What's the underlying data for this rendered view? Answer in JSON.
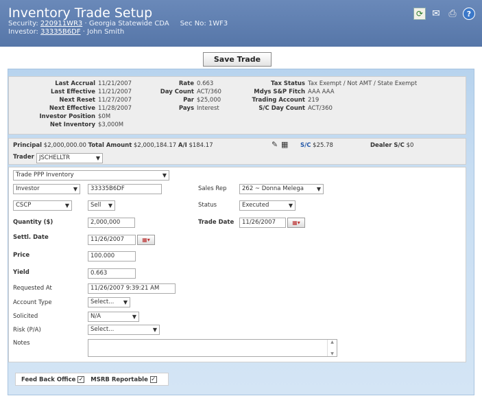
{
  "header": {
    "title": "Inventory Trade Setup",
    "security_label": "Security:",
    "security_id": "220911WR3",
    "security_desc": "· Georgia Statewide CDA",
    "sec_no": "Sec No: 1WF3",
    "investor_label": "Investor:",
    "investor_id": "33335B6DF",
    "investor_name": "· John Smith",
    "icons": [
      "refresh-icon",
      "mail-icon",
      "print-icon",
      "help-icon"
    ]
  },
  "save_label": "Save Trade",
  "summary": {
    "col1": [
      {
        "label": "Last Accrual",
        "value": "11/21/2007"
      },
      {
        "label": "Last Effective",
        "value": "11/21/2007"
      },
      {
        "label": "Next Reset",
        "value": "11/27/2007"
      },
      {
        "label": "Next Effective",
        "value": "11/28/2007"
      },
      {
        "label": "Investor Position",
        "value": "$0M"
      },
      {
        "label": "Net Inventory",
        "value": "$3,000M"
      }
    ],
    "col2": [
      {
        "label": "Rate",
        "value": "0.663"
      },
      {
        "label": "Day Count",
        "value": "ACT/360"
      },
      {
        "label": "Par",
        "value": "$25,000"
      },
      {
        "label": "Pays",
        "value": "Interest"
      }
    ],
    "col3": [
      {
        "label": "Tax Status",
        "value": "Tax Exempt / Not AMT / State Exempt"
      },
      {
        "label": "Mdys S&P Fitch",
        "value": "AAA AAA"
      },
      {
        "label": "Trading Account",
        "value": "219"
      },
      {
        "label": "S/C Day Count",
        "value": "ACT/360"
      }
    ]
  },
  "principal": {
    "principal_label": "Principal",
    "principal_value": "$2,000,000.00",
    "total_label": "Total Amount",
    "total_value": "$2,000,184.17",
    "ai_label": "A/I",
    "ai_value": "$184.17",
    "sc_label": "S/C",
    "sc_value": "$25.78",
    "dealer_label": "Dealer S/C",
    "dealer_value": "$0",
    "trader_label": "Trader",
    "trader_value": "JSCHELLTR"
  },
  "form": {
    "trade_type": "Trade PPP Inventory",
    "party_type": "Investor",
    "party_id": "33335B6DF",
    "sales_rep_label": "Sales Rep",
    "sales_rep_value": "262 ~ Donna Melega",
    "account": "CSCP",
    "side": "Sell",
    "status_label": "Status",
    "status_value": "Executed",
    "quantity_label": "Quantity ($)",
    "quantity_value": "2,000,000",
    "trade_date_label": "Trade Date",
    "trade_date_value": "11/26/2007",
    "settl_date_label": "Settl. Date",
    "settl_date_value": "11/26/2007",
    "price_label": "Price",
    "price_value": "100.000",
    "yield_label": "Yield",
    "yield_value": "0.663",
    "requested_label": "Requested At",
    "requested_value": "11/26/2007 9:39:21 AM",
    "account_type_label": "Account Type",
    "account_type_value": "Select...",
    "solicited_label": "Solicited",
    "solicited_value": "N/A",
    "risk_label": "Risk (P/A)",
    "risk_value": "Select...",
    "notes_label": "Notes",
    "notes_value": ""
  },
  "footer": {
    "feed_back_office_label": "Feed Back Office",
    "feed_back_office_checked": true,
    "msrb_label": "MSRB Reportable",
    "msrb_checked": true
  }
}
